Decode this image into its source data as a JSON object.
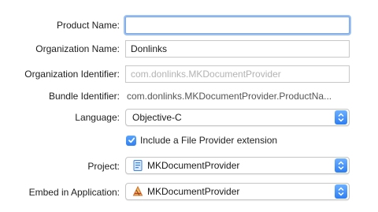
{
  "form": {
    "product_name": {
      "label": "Product Name:",
      "value": ""
    },
    "organization_name": {
      "label": "Organization Name:",
      "value": "Donlinks"
    },
    "organization_identifier": {
      "label": "Organization Identifier:",
      "placeholder": "com.donlinks.MKDocumentProvider"
    },
    "bundle_identifier": {
      "label": "Bundle Identifier:",
      "value": "com.donlinks.MKDocumentProvider.ProductNa..."
    },
    "language": {
      "label": "Language:",
      "selected": "Objective-C"
    },
    "file_provider": {
      "label": "Include a File Provider extension",
      "checked": true
    },
    "project": {
      "label": "Project:",
      "selected": "MKDocumentProvider",
      "icon": "project-file-icon"
    },
    "embed_in_application": {
      "label": "Embed in Application:",
      "selected": "MKDocumentProvider",
      "icon": "app-target-icon"
    }
  },
  "colors": {
    "accent": "#2f7ff3",
    "focus_ring": "#9cc0f2"
  }
}
